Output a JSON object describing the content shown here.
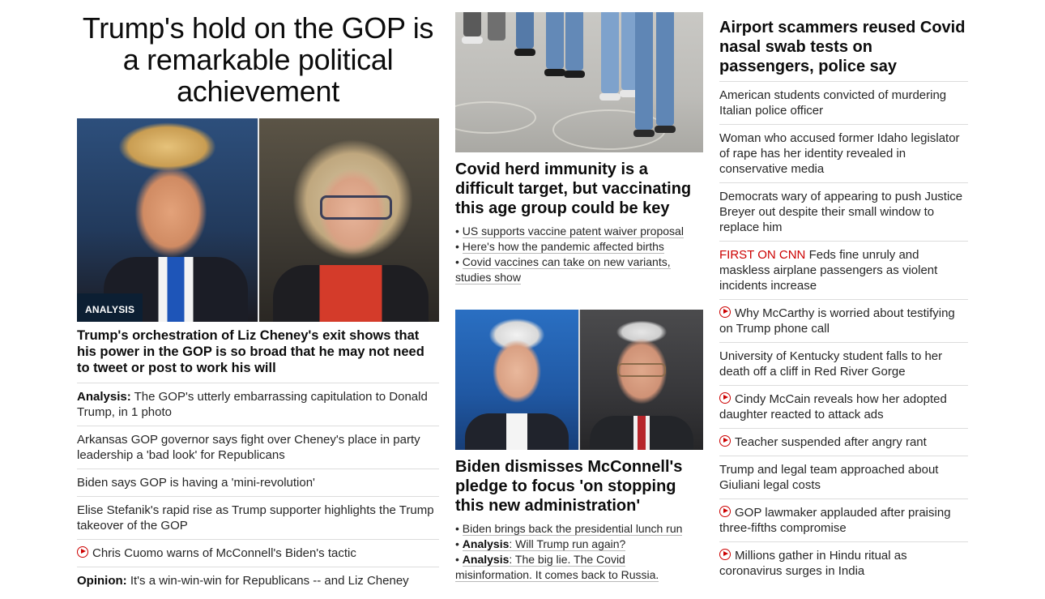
{
  "left": {
    "main_headline": "Trump's hold on the GOP is a remarkable political achievement",
    "badge": "ANALYSIS",
    "hero_headline": "Trump's orchestration of Liz Cheney's exit shows that his power in the GOP is so broad that he may not need to tweet or post to work his will",
    "items": [
      {
        "prefix": "Analysis:",
        "text": " The GOP's utterly embarrassing capitulation to Donald Trump, in 1 photo"
      },
      {
        "text": "Arkansas GOP governor says fight over Cheney's place in party leadership a 'bad look' for Republicans"
      },
      {
        "text": "Biden says GOP is having a 'mini-revolution'"
      },
      {
        "text": "Elise Stefanik's rapid rise as Trump supporter highlights the Trump takeover of the GOP"
      },
      {
        "text": "Chris Cuomo warns of McConnell's Biden's tactic"
      },
      {
        "prefix": "Opinion:",
        "text": " It's a win-win-win for Republicans -- and Liz Cheney"
      }
    ]
  },
  "middle": {
    "story1": {
      "headline": "Covid herd immunity is a difficult target, but vaccinating this age group could be key",
      "bullets": [
        "US supports vaccine patent waiver proposal",
        "Here's how the pandemic affected births",
        "Covid vaccines can take on new variants, studies show"
      ]
    },
    "story2": {
      "headline": "Biden dismisses McConnell's pledge to focus 'on stopping this new administration'",
      "bullets": [
        {
          "text": "Biden brings back the presidential lunch run"
        },
        {
          "prefix": "Analysis",
          "text": ": Will Trump run again?"
        },
        {
          "prefix": "Analysis",
          "text": ": The big lie. The Covid misinformation. It comes back to Russia."
        }
      ]
    }
  },
  "right": {
    "headline": "Airport scammers reused Covid nasal swab tests on passengers, police say",
    "items": [
      {
        "text": "American students convicted of murdering Italian police officer"
      },
      {
        "text": "Woman who accused former Idaho legislator of rape has her identity revealed in conservative media"
      },
      {
        "text": "Democrats wary of appearing to push Justice Breyer out despite their small window to replace him"
      },
      {
        "label": "FIRST ON CNN",
        "text": " Feds fine unruly and maskless airplane passengers as violent incidents increase"
      },
      {
        "text": "Why McCarthy is worried about testifying on Trump phone call"
      },
      {
        "text": "University of Kentucky student falls to her death off a cliff in Red River Gorge"
      },
      {
        "text": "Cindy McCain reveals how her adopted daughter reacted to attack ads"
      },
      {
        "text": "Teacher suspended after angry rant"
      },
      {
        "text": "Trump and legal team approached about Giuliani legal costs"
      },
      {
        "text": "GOP lawmaker applauded after praising three-fifths compromise"
      },
      {
        "text": "Millions gather in Hindu ritual as coronavirus surges in India"
      }
    ]
  },
  "colors": {
    "accent_red": "#cc0000",
    "badge_bg": "#0c1f33",
    "divider": "#dcdcdc"
  },
  "icons": {
    "video": "play-circle-icon"
  }
}
